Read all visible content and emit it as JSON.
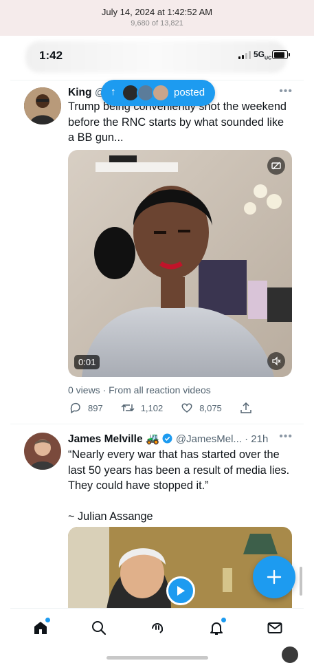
{
  "photos_header": {
    "date": "July 14, 2024 at 1:42:52 AM",
    "count": "9,680 of 13,821"
  },
  "status_bar": {
    "time": "1:42",
    "network": "5G",
    "network_sub": "UC"
  },
  "posted_pill": {
    "label": "posted"
  },
  "tweets": [
    {
      "name": "King",
      "handle": "@",
      "text": "Trump being conveniently shot the weekend before the RNC starts by what sounded like a BB gun...",
      "video_time": "0:01",
      "views_line": "0 views · From all reaction videos",
      "replies": "897",
      "retweets": "1,102",
      "likes": "8,075"
    },
    {
      "name": "James Melville",
      "emoji": "🚜",
      "handle": "@JamesMel... · 21h",
      "text": "“Nearly every war that has started over the last 50 years has been a result of media lies. They could have stopped it.”",
      "attribution": "~ Julian Assange"
    }
  ],
  "colors": {
    "accent": "#1d9bf0",
    "text_primary": "#0f1419",
    "text_secondary": "#536471",
    "header_bg": "#f5ebeb"
  },
  "icons": {
    "nav": [
      "home-icon",
      "search-icon",
      "spaces-icon",
      "notifications-icon",
      "messages-icon"
    ],
    "compose": "plus-icon"
  }
}
